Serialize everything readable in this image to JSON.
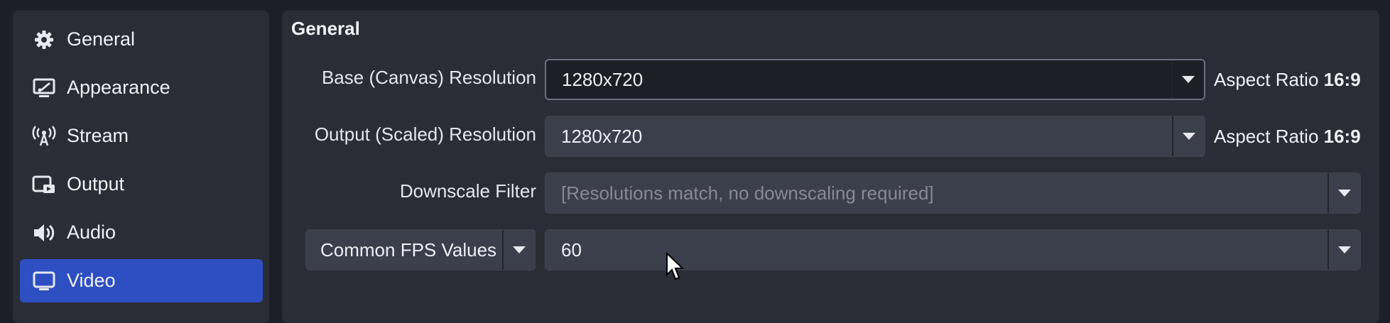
{
  "sidebar": {
    "items": [
      {
        "label": "General",
        "icon": "gear-icon"
      },
      {
        "label": "Appearance",
        "icon": "appearance-icon"
      },
      {
        "label": "Stream",
        "icon": "antenna-icon"
      },
      {
        "label": "Output",
        "icon": "output-icon"
      },
      {
        "label": "Audio",
        "icon": "speaker-icon"
      },
      {
        "label": "Video",
        "icon": "monitor-icon",
        "active": true
      }
    ]
  },
  "video": {
    "section_title": "General",
    "base_resolution": {
      "label": "Base (Canvas) Resolution",
      "value": "1280x720",
      "aspect_prefix": "Aspect Ratio",
      "aspect_value": "16:9"
    },
    "output_resolution": {
      "label": "Output (Scaled) Resolution",
      "value": "1280x720",
      "aspect_prefix": "Aspect Ratio",
      "aspect_value": "16:9"
    },
    "downscale_filter": {
      "label": "Downscale Filter",
      "value": "[Resolutions match, no downscaling required]"
    },
    "fps": {
      "type_value": "Common FPS Values",
      "value": "60"
    }
  },
  "colors": {
    "accent": "#2d4fc2",
    "panel": "#2a2c36",
    "background": "#1d1f26"
  }
}
